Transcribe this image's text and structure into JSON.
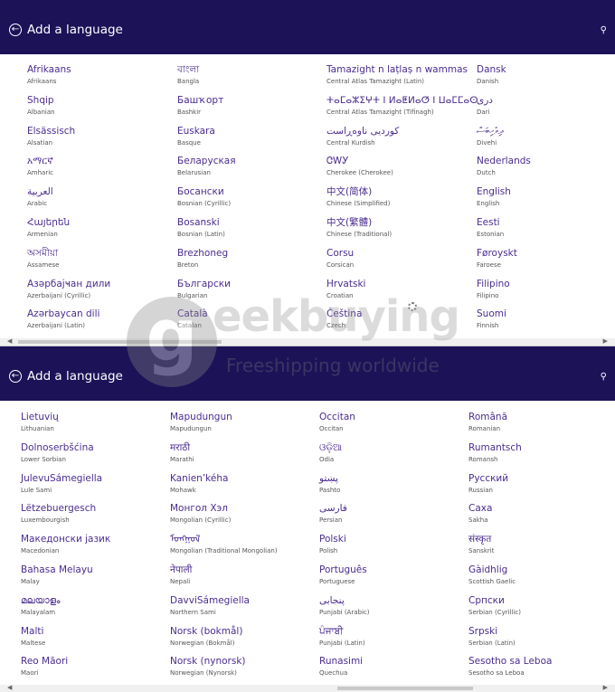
{
  "header": {
    "title": "Add a language"
  },
  "top_columns": [
    [
      {
        "name": "Afrikaans",
        "sub": "Afrikaans"
      },
      {
        "name": "Shqip",
        "sub": "Albanian"
      },
      {
        "name": "Elsässisch",
        "sub": "Alsatian"
      },
      {
        "name": "አማርኛ",
        "sub": "Amharic"
      },
      {
        "name": "العربية",
        "sub": "Arabic"
      },
      {
        "name": "Հայերեն",
        "sub": "Armenian"
      },
      {
        "name": "অসমীয়া",
        "sub": "Assamese"
      },
      {
        "name": "Азәрбајҹан дили",
        "sub": "Azerbaijani (Cyrillic)"
      },
      {
        "name": "Azərbaycan dili",
        "sub": "Azerbaijani (Latin)"
      }
    ],
    [
      {
        "name": "বাংলা",
        "sub": "Bangla"
      },
      {
        "name": "Башҡорт",
        "sub": "Bashkir"
      },
      {
        "name": "Euskara",
        "sub": "Basque"
      },
      {
        "name": "Беларуская",
        "sub": "Belarusian"
      },
      {
        "name": "Босански",
        "sub": "Bosnian (Cyrillic)"
      },
      {
        "name": "Bosanski",
        "sub": "Bosnian (Latin)"
      },
      {
        "name": "Brezhoneg",
        "sub": "Breton"
      },
      {
        "name": "Български",
        "sub": "Bulgarian"
      },
      {
        "name": "Català",
        "sub": "Catalan"
      }
    ],
    [
      {
        "name": "Tamazight n laṭlaṣ n wammas",
        "sub": "Central Atlas Tamazight (Latin)"
      },
      {
        "name": "ⵜⴰⵎⴰⵣⵉⵖⵜ ⵏ ⵍⴰⵟⵍⴰⵚ ⵏ ⵡⴰⵎⵎⴰⵙ",
        "sub": "Central Atlas Tamazight (Tifinagh)"
      },
      {
        "name": "کوردیی ناوەڕاست",
        "sub": "Central Kurdish"
      },
      {
        "name": "ᏣᎳᎩ",
        "sub": "Cherokee (Cherokee)"
      },
      {
        "name": "中文(简体)",
        "sub": "Chinese (Simplified)"
      },
      {
        "name": "中文(繁體)",
        "sub": "Chinese (Traditional)"
      },
      {
        "name": "Corsu",
        "sub": "Corsican"
      },
      {
        "name": "Hrvatski",
        "sub": "Croatian"
      },
      {
        "name": "Čeština",
        "sub": "Czech"
      }
    ],
    [
      {
        "name": "Dansk",
        "sub": "Danish"
      },
      {
        "name": "دری",
        "sub": "Dari"
      },
      {
        "name": "ދިވެހިބަސް",
        "sub": "Divehi"
      },
      {
        "name": "Nederlands",
        "sub": "Dutch"
      },
      {
        "name": "English",
        "sub": "English"
      },
      {
        "name": "Eesti",
        "sub": "Estonian"
      },
      {
        "name": "Føroyskt",
        "sub": "Faroese"
      },
      {
        "name": "Filipino",
        "sub": "Filipino"
      },
      {
        "name": "Suomi",
        "sub": "Finnish"
      }
    ]
  ],
  "bottom_columns": [
    [
      {
        "name": "Lietuvių",
        "sub": "Lithuanian"
      },
      {
        "name": "Dolnoserbšćina",
        "sub": "Lower Sorbian"
      },
      {
        "name": "JulevuSámegiella",
        "sub": "Lule Sami"
      },
      {
        "name": "Lëtzebuergesch",
        "sub": "Luxembourgish"
      },
      {
        "name": "Македонски јазик",
        "sub": "Macedonian"
      },
      {
        "name": "Bahasa Melayu",
        "sub": "Malay"
      },
      {
        "name": "മലയാളം",
        "sub": "Malayalam"
      },
      {
        "name": "Malti",
        "sub": "Maltese"
      },
      {
        "name": "Reo Māori",
        "sub": "Maori"
      }
    ],
    [
      {
        "name": "Mapudungun",
        "sub": "Mapudungun"
      },
      {
        "name": "मराठी",
        "sub": "Marathi"
      },
      {
        "name": "Kanien’kéha",
        "sub": "Mohawk"
      },
      {
        "name": "Монгол Хэл",
        "sub": "Mongolian (Cyrillic)"
      },
      {
        "name": "ᠮᠣᠩᠭᠣᠯ",
        "sub": "Mongolian (Traditional Mongolian)"
      },
      {
        "name": "नेपाली",
        "sub": "Nepali"
      },
      {
        "name": "DavviSámegiella",
        "sub": "Northern Sami"
      },
      {
        "name": "Norsk (bokmål)",
        "sub": "Norwegian (Bokmål)"
      },
      {
        "name": "Norsk (nynorsk)",
        "sub": "Norwegian (Nynorsk)"
      }
    ],
    [
      {
        "name": "Occitan",
        "sub": "Occitan"
      },
      {
        "name": "ଓଡ଼ିଆ",
        "sub": "Odia"
      },
      {
        "name": "پښتو",
        "sub": "Pashto"
      },
      {
        "name": "فارسی",
        "sub": "Persian"
      },
      {
        "name": "Polski",
        "sub": "Polish"
      },
      {
        "name": "Português",
        "sub": "Portuguese"
      },
      {
        "name": "پنجابی",
        "sub": "Punjabi (Arabic)"
      },
      {
        "name": "ਪੰਜਾਬੀ",
        "sub": "Punjabi (Latin)"
      },
      {
        "name": "Runasimi",
        "sub": "Quechua"
      }
    ],
    [
      {
        "name": "Română",
        "sub": "Romanian"
      },
      {
        "name": "Rumantsch",
        "sub": "Romansh"
      },
      {
        "name": "Русский",
        "sub": "Russian"
      },
      {
        "name": "Саха",
        "sub": "Sakha"
      },
      {
        "name": "संस्कृत",
        "sub": "Sanskrit"
      },
      {
        "name": "Gàidhlig",
        "sub": "Scottish Gaelic"
      },
      {
        "name": "Српски",
        "sub": "Serbian (Cyrillic)"
      },
      {
        "name": "Srpski",
        "sub": "Serbian (Latin)"
      },
      {
        "name": "Sesotho sa Leboa",
        "sub": "Sesotho sa Leboa"
      }
    ]
  ],
  "watermark": {
    "letter": "g",
    "brand": "eekbuying",
    "tagline": "Freeshipping worldwide"
  },
  "colors": {
    "header_bg": "#1c1258",
    "link": "#4b2c8f"
  }
}
